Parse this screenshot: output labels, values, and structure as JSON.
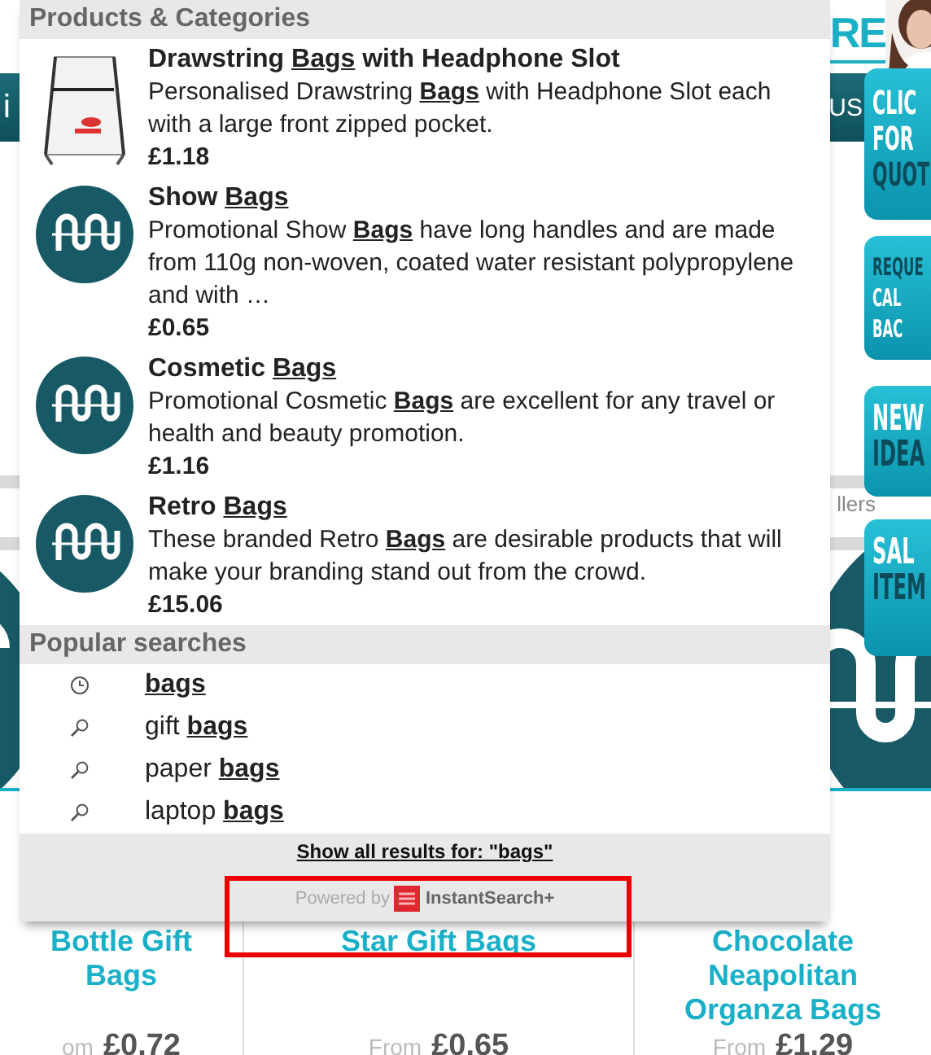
{
  "background_page": {
    "header_link": "RE",
    "nav_left": "i",
    "nav_right": "US",
    "tab_fragment": "llers",
    "side_buttons": [
      {
        "lines": [
          {
            "text": "CLIC",
            "kind": "light"
          },
          {
            "text": "FOR",
            "kind": "light"
          },
          {
            "text": "QUOT",
            "kind": "dark"
          }
        ]
      },
      {
        "lines": [
          {
            "text": "REQUE",
            "kind": "dark"
          },
          {
            "text": "CAL",
            "kind": "light"
          },
          {
            "text": "BAC",
            "kind": "light"
          }
        ]
      },
      {
        "lines": [
          {
            "text": "NEW",
            "kind": "light"
          },
          {
            "text": "IDEA",
            "kind": "dark"
          }
        ]
      },
      {
        "lines": [
          {
            "text": "SAL",
            "kind": "light"
          },
          {
            "text": "ITEM",
            "kind": "dark"
          }
        ]
      }
    ],
    "products": [
      {
        "title": "Bottle Gift Bags",
        "from": "om",
        "price": "£0.72"
      },
      {
        "title": "Star Gift Bags",
        "from": "From",
        "price": "£0.65"
      },
      {
        "title": "Chocolate Neapolitan Organza Bags",
        "from": "From",
        "price": "£1.29"
      }
    ]
  },
  "search_dropdown": {
    "products_heading": "Products & Categories",
    "products": [
      {
        "kind": "picture",
        "name": "Drawstring **Bags** with Headphone Slot",
        "description": "Personalised Drawstring **Bags** with Headphone Slot each with a large front zipped pocket.",
        "price": "£1.18"
      },
      {
        "kind": "logo",
        "name": "Show **Bags**",
        "description": "Promotional Show **Bags** have long handles and are made from 110g non-woven, coated water resistant polypropylene and with …",
        "price": "£0.65"
      },
      {
        "kind": "logo",
        "name": "Cosmetic **Bags**",
        "description": "Promotional Cosmetic **Bags** are excellent for any travel or health and beauty promotion.",
        "price": "£1.16"
      },
      {
        "kind": "logo",
        "name": "Retro **Bags**",
        "description": "These branded Retro **Bags** are desirable products that will make your branding stand out from the crowd.",
        "price": "£15.06"
      }
    ],
    "popular_heading": "Popular searches",
    "popular_searches": [
      {
        "kind": "recent",
        "text": "**bags**"
      },
      {
        "kind": "search",
        "text": "gift **bags**"
      },
      {
        "kind": "search",
        "text": "paper **bags**"
      },
      {
        "kind": "search",
        "text": "laptop **bags**"
      }
    ],
    "show_all": "Show all results for: \"bags\"",
    "powered_by": "Powered by",
    "brand": "InstantSearch+",
    "highlighted": true
  }
}
